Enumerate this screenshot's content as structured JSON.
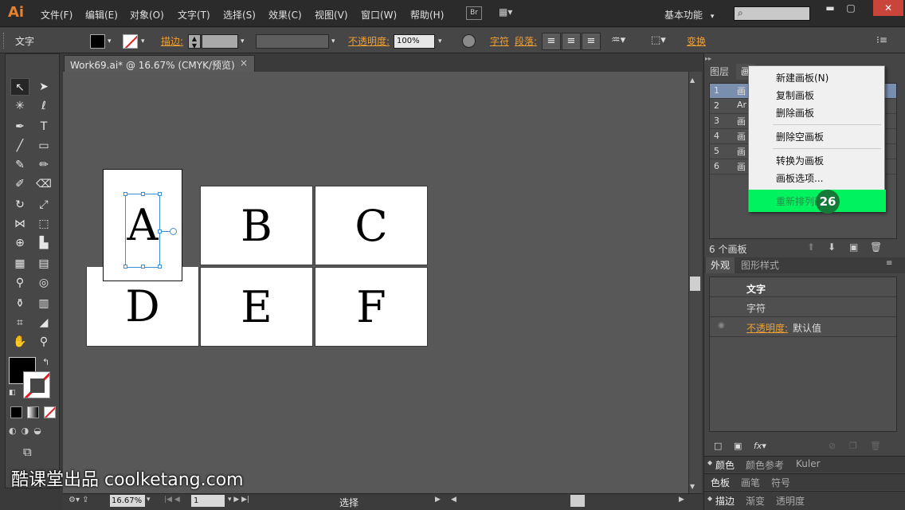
{
  "app": {
    "logo": "Ai"
  },
  "menubar": {
    "items": [
      "文件(F)",
      "编辑(E)",
      "对象(O)",
      "文字(T)",
      "选择(S)",
      "效果(C)",
      "视图(V)",
      "窗口(W)",
      "帮助(H)"
    ],
    "bridge_label": "Br",
    "workspace": "基本功能",
    "workspace_arrow": "▾"
  },
  "control_bar": {
    "tool_label": "文字",
    "stroke_label": "描边:",
    "opacity_label": "不透明度:",
    "opacity_value": "100%",
    "character_label": "字符",
    "paragraph_label": "段落:",
    "transform_label": "变换"
  },
  "document": {
    "tab_title": "Work69.ai* @ 16.67% (CMYK/预览)",
    "close": "×"
  },
  "artboards": [
    {
      "letter": "A"
    },
    {
      "letter": "B"
    },
    {
      "letter": "C"
    },
    {
      "letter": "D"
    },
    {
      "letter": "E"
    },
    {
      "letter": "F"
    }
  ],
  "status_bar": {
    "zoom": "16.67%",
    "page": "1",
    "tool": "选择"
  },
  "panels": {
    "layers_tab": "图层",
    "artboards_tab": "画",
    "artboard_rows": [
      {
        "num": "1",
        "icon": "画"
      },
      {
        "num": "2",
        "icon": "Ar"
      },
      {
        "num": "3",
        "icon": "画"
      },
      {
        "num": "4",
        "icon": "画"
      },
      {
        "num": "5",
        "icon": "画"
      },
      {
        "num": "6",
        "icon": "画"
      }
    ],
    "artboard_count": "6 个画板",
    "appearance_tab": "外观",
    "graphic_styles_tab": "图形样式",
    "appearance_title": "文字",
    "appearance_row_character": "字符",
    "appearance_opacity_label": "不透明度:",
    "appearance_opacity_value": "默认值",
    "bottom_tabs_1": [
      "颜色",
      "颜色参考",
      "Kuler"
    ],
    "bottom_tabs_2": [
      "色板",
      "画笔",
      "符号"
    ],
    "bottom_tabs_3": [
      "描边",
      "渐变",
      "透明度"
    ]
  },
  "context_menu": {
    "items": [
      "新建画板(N)",
      "复制画板",
      "删除画板",
      "删除空画板",
      "转换为画板",
      "画板选项...",
      "重新排列画"
    ],
    "highlight_color": "#00f25e"
  },
  "step_badge": "26",
  "watermark": "酷课堂出品 coolketang.com"
}
